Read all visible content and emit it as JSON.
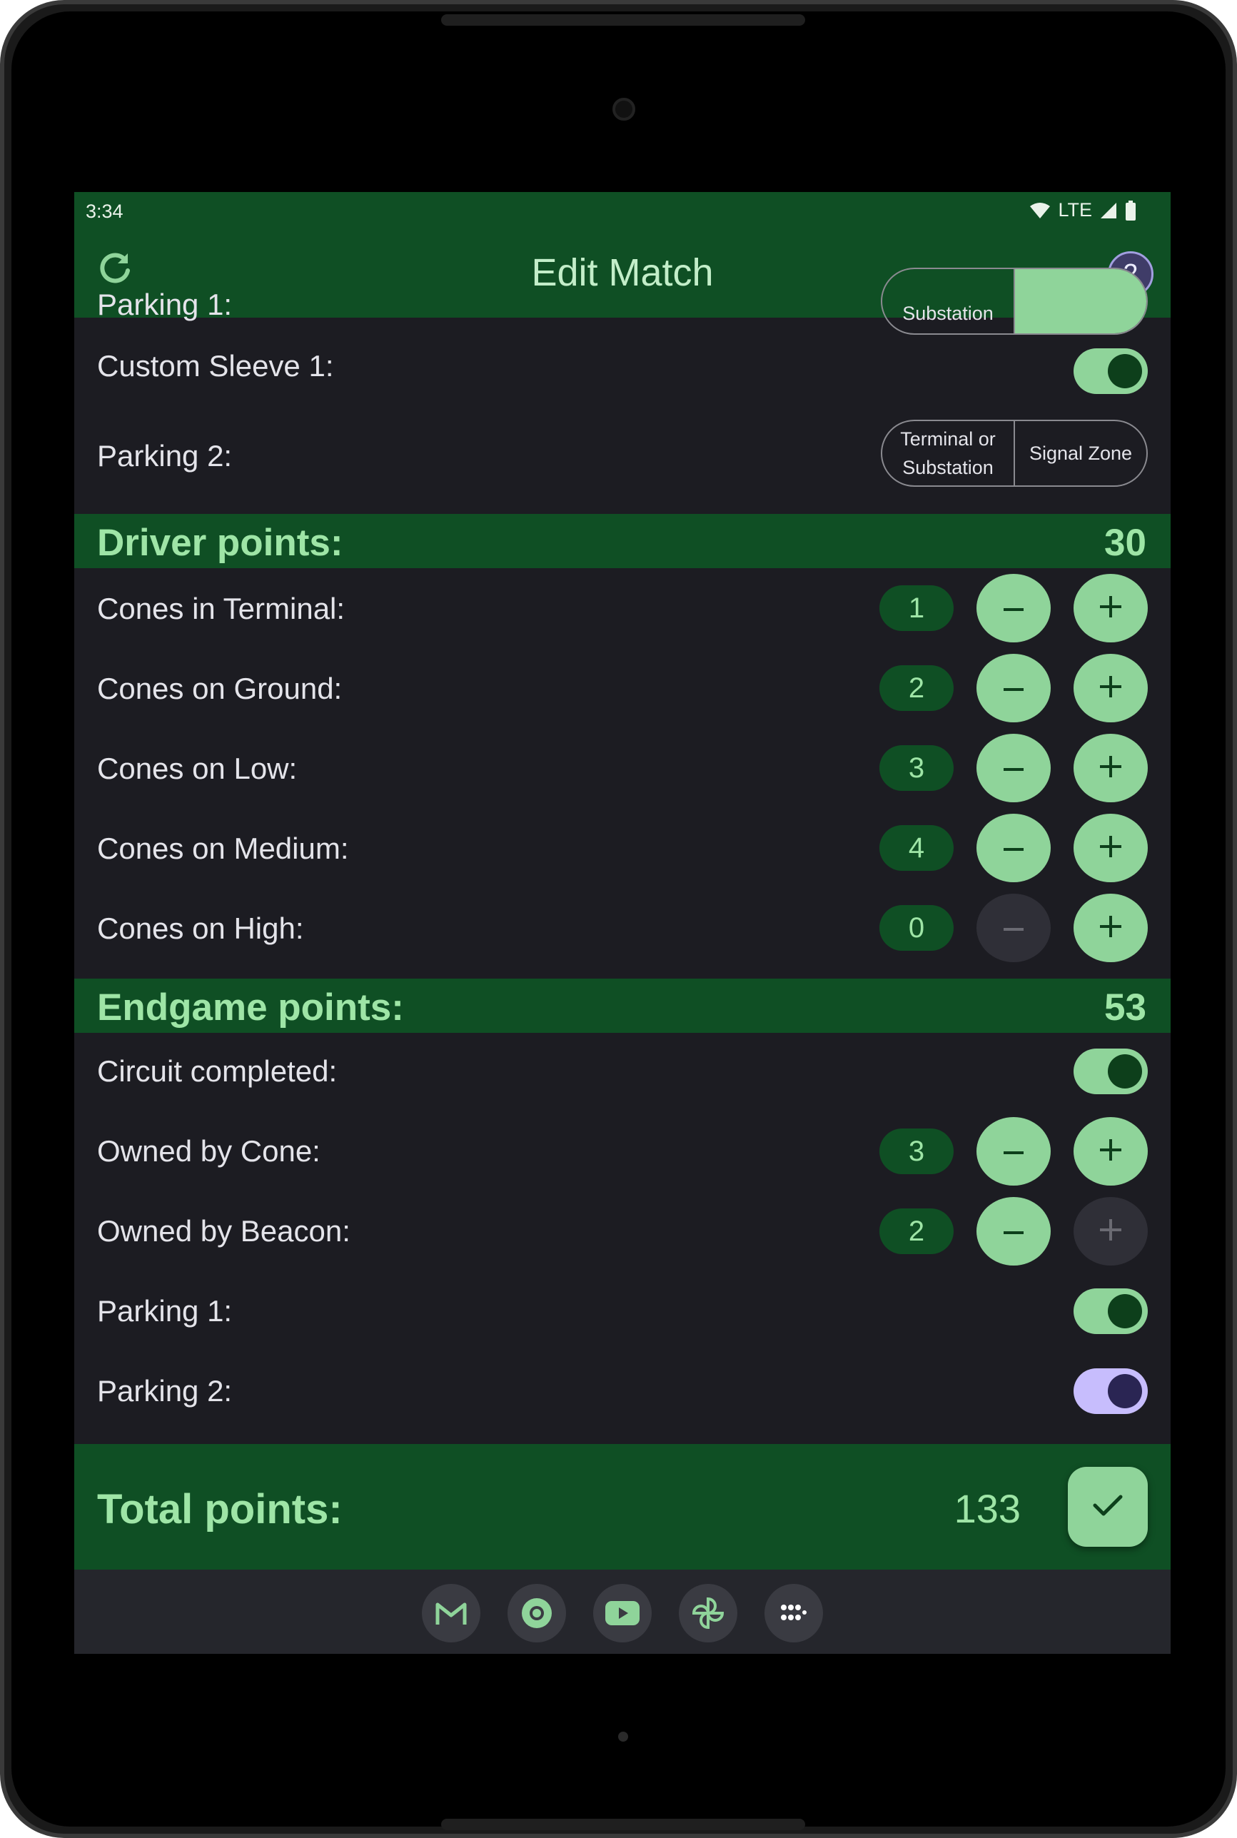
{
  "status": {
    "time": "3:34",
    "network": "LTE"
  },
  "app": {
    "title": "Edit Match",
    "match_count": "2"
  },
  "partial_top": {
    "label": "Parking 1:",
    "seg_left": "Substation"
  },
  "custom_sleeve": {
    "label": "Custom Sleeve 1:",
    "on": true
  },
  "parking2_auto": {
    "label": "Parking 2:",
    "options": [
      "Terminal or\nSubstation",
      "Signal Zone"
    ]
  },
  "driver": {
    "title": "Driver points:",
    "value": "30",
    "rows": [
      {
        "label": "Cones in Terminal:",
        "value": "1"
      },
      {
        "label": "Cones on Ground:",
        "value": "2"
      },
      {
        "label": "Cones on Low:",
        "value": "3"
      },
      {
        "label": "Cones on Medium:",
        "value": "4"
      },
      {
        "label": "Cones on High:",
        "value": "0"
      }
    ]
  },
  "endgame": {
    "title": "Endgame points:",
    "value": "53",
    "circuit": {
      "label": "Circuit completed:",
      "on": true
    },
    "owned_cone": {
      "label": "Owned by Cone:",
      "value": "3"
    },
    "owned_beacon": {
      "label": "Owned by Beacon:",
      "value": "2"
    },
    "parking1": {
      "label": "Parking 1:",
      "on": true
    },
    "parking2": {
      "label": "Parking 2:",
      "on": true
    }
  },
  "total": {
    "label": "Total points:",
    "value": "133"
  },
  "taskbar": {
    "icons": [
      "gmail-icon",
      "chrome-icon",
      "youtube-icon",
      "photos-icon",
      "app-drawer-icon"
    ]
  },
  "colors": {
    "bar": "#0f4f24",
    "accent": "#8fd49a",
    "background": "#1c1c22",
    "accent_text": "#9ee5a6"
  }
}
